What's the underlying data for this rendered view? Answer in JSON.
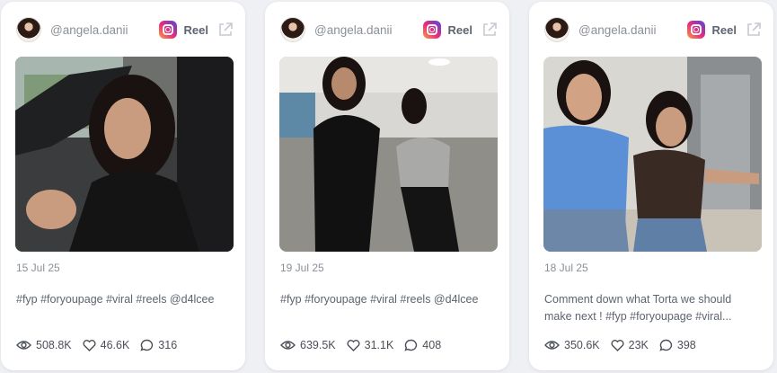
{
  "cards": [
    {
      "handle": "@angela.danii",
      "platform_icon": "instagram-icon",
      "type": "Reel",
      "date": "15 Jul 25",
      "caption": "#fyp #foryoupage #viral #reels @d4lcee",
      "views": "508.8K",
      "likes": "46.6K",
      "comments": "316"
    },
    {
      "handle": "@angela.danii",
      "platform_icon": "instagram-icon",
      "type": "Reel",
      "date": "19 Jul 25",
      "caption": "#fyp #foryoupage #viral #reels @d4lcee",
      "views": "639.5K",
      "likes": "31.1K",
      "comments": "408"
    },
    {
      "handle": "@angela.danii",
      "platform_icon": "instagram-icon",
      "type": "Reel",
      "date": "18 Jul 25",
      "caption": "Comment down what Torta we should make next ! #fyp #foryoupage #viral...",
      "views": "350.6K",
      "likes": "23K",
      "comments": "398"
    }
  ],
  "icons": {
    "views": "eye-icon",
    "likes": "heart-icon",
    "comments": "comment-icon",
    "open": "external-link-icon"
  }
}
